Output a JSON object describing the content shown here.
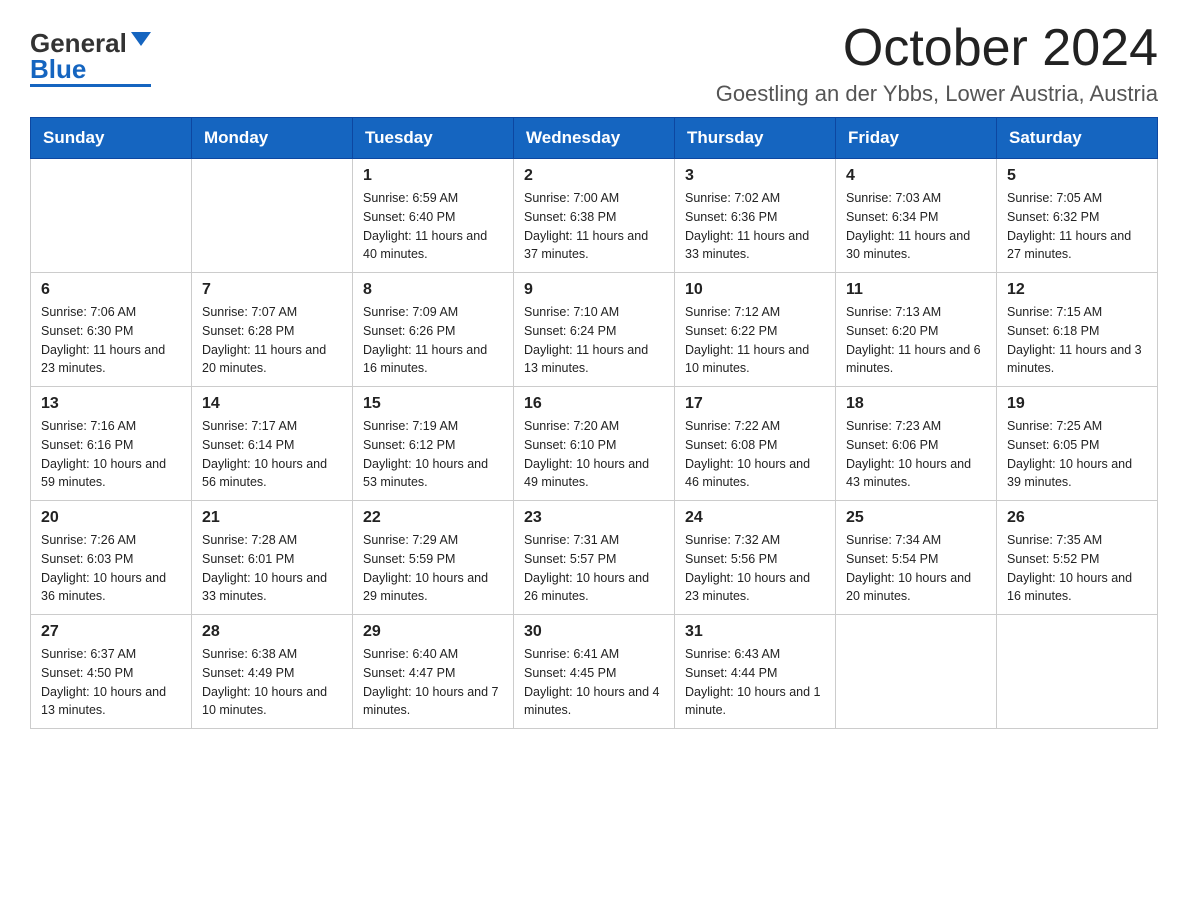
{
  "logo": {
    "general": "General",
    "blue": "Blue"
  },
  "header": {
    "month": "October 2024",
    "location": "Goestling an der Ybbs, Lower Austria, Austria"
  },
  "weekdays": [
    "Sunday",
    "Monday",
    "Tuesday",
    "Wednesday",
    "Thursday",
    "Friday",
    "Saturday"
  ],
  "weeks": [
    [
      {
        "day": "",
        "sunrise": "",
        "sunset": "",
        "daylight": ""
      },
      {
        "day": "",
        "sunrise": "",
        "sunset": "",
        "daylight": ""
      },
      {
        "day": "1",
        "sunrise": "Sunrise: 6:59 AM",
        "sunset": "Sunset: 6:40 PM",
        "daylight": "Daylight: 11 hours and 40 minutes."
      },
      {
        "day": "2",
        "sunrise": "Sunrise: 7:00 AM",
        "sunset": "Sunset: 6:38 PM",
        "daylight": "Daylight: 11 hours and 37 minutes."
      },
      {
        "day": "3",
        "sunrise": "Sunrise: 7:02 AM",
        "sunset": "Sunset: 6:36 PM",
        "daylight": "Daylight: 11 hours and 33 minutes."
      },
      {
        "day": "4",
        "sunrise": "Sunrise: 7:03 AM",
        "sunset": "Sunset: 6:34 PM",
        "daylight": "Daylight: 11 hours and 30 minutes."
      },
      {
        "day": "5",
        "sunrise": "Sunrise: 7:05 AM",
        "sunset": "Sunset: 6:32 PM",
        "daylight": "Daylight: 11 hours and 27 minutes."
      }
    ],
    [
      {
        "day": "6",
        "sunrise": "Sunrise: 7:06 AM",
        "sunset": "Sunset: 6:30 PM",
        "daylight": "Daylight: 11 hours and 23 minutes."
      },
      {
        "day": "7",
        "sunrise": "Sunrise: 7:07 AM",
        "sunset": "Sunset: 6:28 PM",
        "daylight": "Daylight: 11 hours and 20 minutes."
      },
      {
        "day": "8",
        "sunrise": "Sunrise: 7:09 AM",
        "sunset": "Sunset: 6:26 PM",
        "daylight": "Daylight: 11 hours and 16 minutes."
      },
      {
        "day": "9",
        "sunrise": "Sunrise: 7:10 AM",
        "sunset": "Sunset: 6:24 PM",
        "daylight": "Daylight: 11 hours and 13 minutes."
      },
      {
        "day": "10",
        "sunrise": "Sunrise: 7:12 AM",
        "sunset": "Sunset: 6:22 PM",
        "daylight": "Daylight: 11 hours and 10 minutes."
      },
      {
        "day": "11",
        "sunrise": "Sunrise: 7:13 AM",
        "sunset": "Sunset: 6:20 PM",
        "daylight": "Daylight: 11 hours and 6 minutes."
      },
      {
        "day": "12",
        "sunrise": "Sunrise: 7:15 AM",
        "sunset": "Sunset: 6:18 PM",
        "daylight": "Daylight: 11 hours and 3 minutes."
      }
    ],
    [
      {
        "day": "13",
        "sunrise": "Sunrise: 7:16 AM",
        "sunset": "Sunset: 6:16 PM",
        "daylight": "Daylight: 10 hours and 59 minutes."
      },
      {
        "day": "14",
        "sunrise": "Sunrise: 7:17 AM",
        "sunset": "Sunset: 6:14 PM",
        "daylight": "Daylight: 10 hours and 56 minutes."
      },
      {
        "day": "15",
        "sunrise": "Sunrise: 7:19 AM",
        "sunset": "Sunset: 6:12 PM",
        "daylight": "Daylight: 10 hours and 53 minutes."
      },
      {
        "day": "16",
        "sunrise": "Sunrise: 7:20 AM",
        "sunset": "Sunset: 6:10 PM",
        "daylight": "Daylight: 10 hours and 49 minutes."
      },
      {
        "day": "17",
        "sunrise": "Sunrise: 7:22 AM",
        "sunset": "Sunset: 6:08 PM",
        "daylight": "Daylight: 10 hours and 46 minutes."
      },
      {
        "day": "18",
        "sunrise": "Sunrise: 7:23 AM",
        "sunset": "Sunset: 6:06 PM",
        "daylight": "Daylight: 10 hours and 43 minutes."
      },
      {
        "day": "19",
        "sunrise": "Sunrise: 7:25 AM",
        "sunset": "Sunset: 6:05 PM",
        "daylight": "Daylight: 10 hours and 39 minutes."
      }
    ],
    [
      {
        "day": "20",
        "sunrise": "Sunrise: 7:26 AM",
        "sunset": "Sunset: 6:03 PM",
        "daylight": "Daylight: 10 hours and 36 minutes."
      },
      {
        "day": "21",
        "sunrise": "Sunrise: 7:28 AM",
        "sunset": "Sunset: 6:01 PM",
        "daylight": "Daylight: 10 hours and 33 minutes."
      },
      {
        "day": "22",
        "sunrise": "Sunrise: 7:29 AM",
        "sunset": "Sunset: 5:59 PM",
        "daylight": "Daylight: 10 hours and 29 minutes."
      },
      {
        "day": "23",
        "sunrise": "Sunrise: 7:31 AM",
        "sunset": "Sunset: 5:57 PM",
        "daylight": "Daylight: 10 hours and 26 minutes."
      },
      {
        "day": "24",
        "sunrise": "Sunrise: 7:32 AM",
        "sunset": "Sunset: 5:56 PM",
        "daylight": "Daylight: 10 hours and 23 minutes."
      },
      {
        "day": "25",
        "sunrise": "Sunrise: 7:34 AM",
        "sunset": "Sunset: 5:54 PM",
        "daylight": "Daylight: 10 hours and 20 minutes."
      },
      {
        "day": "26",
        "sunrise": "Sunrise: 7:35 AM",
        "sunset": "Sunset: 5:52 PM",
        "daylight": "Daylight: 10 hours and 16 minutes."
      }
    ],
    [
      {
        "day": "27",
        "sunrise": "Sunrise: 6:37 AM",
        "sunset": "Sunset: 4:50 PM",
        "daylight": "Daylight: 10 hours and 13 minutes."
      },
      {
        "day": "28",
        "sunrise": "Sunrise: 6:38 AM",
        "sunset": "Sunset: 4:49 PM",
        "daylight": "Daylight: 10 hours and 10 minutes."
      },
      {
        "day": "29",
        "sunrise": "Sunrise: 6:40 AM",
        "sunset": "Sunset: 4:47 PM",
        "daylight": "Daylight: 10 hours and 7 minutes."
      },
      {
        "day": "30",
        "sunrise": "Sunrise: 6:41 AM",
        "sunset": "Sunset: 4:45 PM",
        "daylight": "Daylight: 10 hours and 4 minutes."
      },
      {
        "day": "31",
        "sunrise": "Sunrise: 6:43 AM",
        "sunset": "Sunset: 4:44 PM",
        "daylight": "Daylight: 10 hours and 1 minute."
      },
      {
        "day": "",
        "sunrise": "",
        "sunset": "",
        "daylight": ""
      },
      {
        "day": "",
        "sunrise": "",
        "sunset": "",
        "daylight": ""
      }
    ]
  ]
}
